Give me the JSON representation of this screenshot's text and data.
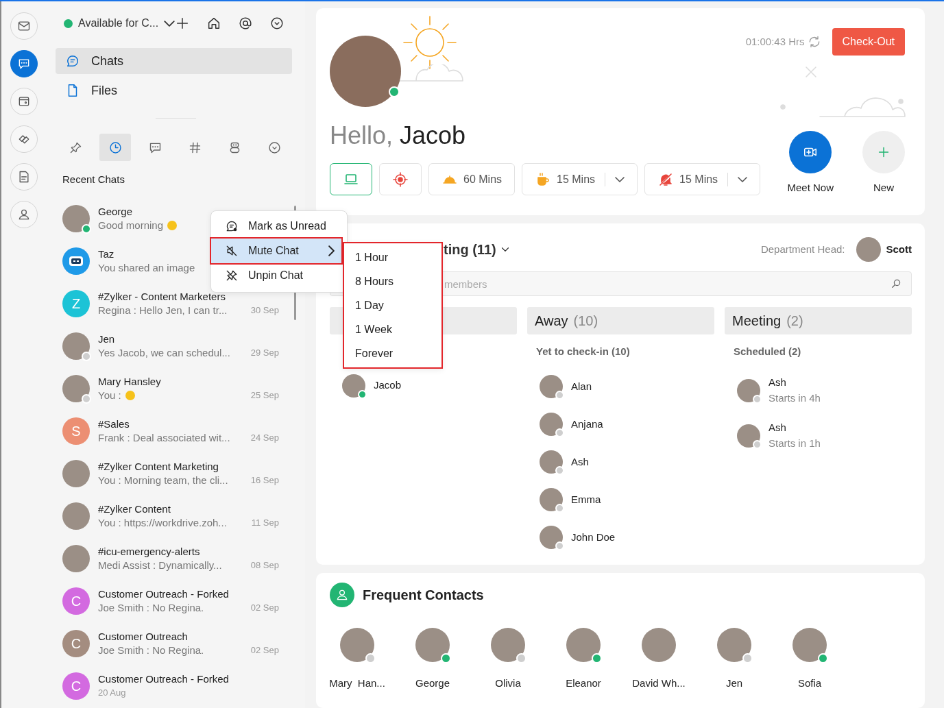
{
  "rail": [
    {
      "kind": "mail",
      "selected": false
    },
    {
      "kind": "chat",
      "selected": true
    },
    {
      "kind": "wallet",
      "selected": false
    },
    {
      "kind": "tag",
      "selected": false
    },
    {
      "kind": "note",
      "selected": false
    },
    {
      "kind": "person",
      "selected": false
    }
  ],
  "sidebar": {
    "status": {
      "label": "Available for C...",
      "color": "#22b573"
    },
    "nav": [
      {
        "kind": "chats",
        "label": "Chats",
        "selected": true
      },
      {
        "kind": "files",
        "label": "Files",
        "selected": false
      }
    ],
    "tabs": [
      {
        "kind": "pin",
        "selected": false
      },
      {
        "kind": "clock",
        "selected": true
      },
      {
        "kind": "chat",
        "selected": false
      },
      {
        "kind": "hash",
        "selected": false
      },
      {
        "kind": "bot",
        "selected": false
      },
      {
        "kind": "more",
        "selected": false
      }
    ],
    "section_title": "Recent Chats",
    "chats": [
      {
        "name": "George",
        "preview": "Good morning",
        "emoji": true,
        "avatar": {
          "kind": "photo"
        },
        "online": true
      },
      {
        "name": "Taz",
        "preview": "You shared an image",
        "avatar": {
          "kind": "bot"
        }
      },
      {
        "name": "#Zylker - Content Marketers",
        "preview": "Regina : Hello Jen, I can tr...",
        "time": "30 Sep",
        "avatar": {
          "kind": "letter",
          "letter": "Z",
          "color": "#1cc3d6"
        }
      },
      {
        "name": "Jen",
        "preview": "Yes Jacob, we can schedul...",
        "time": "29 Sep",
        "avatar": {
          "kind": "photo"
        },
        "online": false
      },
      {
        "name": "Mary Hansley",
        "preview": "You :",
        "emoji": true,
        "time": "25 Sep",
        "avatar": {
          "kind": "photo"
        },
        "online": false
      },
      {
        "name": "#Sales",
        "preview": "Frank : Deal associated wit...",
        "time": "24 Sep",
        "avatar": {
          "kind": "letter",
          "letter": "S",
          "color": "#ec8f73"
        }
      },
      {
        "name": "#Zylker Content Marketing",
        "preview": "You : Morning team, the cli...",
        "time": "16 Sep",
        "avatar": {
          "kind": "photo"
        }
      },
      {
        "name": "#Zylker Content",
        "preview": "You : https://workdrive.zoh...",
        "time": "11 Sep",
        "avatar": {
          "kind": "photo"
        }
      },
      {
        "name": "#icu-emergency-alerts",
        "preview": "Medi Assist : Dynamically...",
        "time": "08 Sep",
        "avatar": {
          "kind": "photo"
        }
      },
      {
        "name": "Customer Outreach - Forked",
        "preview": "Joe Smith : No Regina.",
        "time": "02 Sep",
        "avatar": {
          "kind": "letter",
          "letter": "C",
          "color": "#d36ae0"
        }
      },
      {
        "name": "Customer Outreach",
        "preview": "Joe Smith : No Regina.",
        "time": "02 Sep",
        "avatar": {
          "kind": "letter",
          "letter": "C",
          "color": "#a48d80"
        }
      },
      {
        "name": "Customer Outreach - Forked",
        "time": "20 Aug",
        "avatar": {
          "kind": "letter",
          "letter": "C",
          "color": "#d36ae0"
        }
      }
    ]
  },
  "context_menu": {
    "items": [
      {
        "kind": "unread",
        "label": "Mark as Unread",
        "selected": false
      },
      {
        "kind": "mute",
        "label": "Mute Chat",
        "selected": true,
        "submenu": true
      },
      {
        "kind": "unpin",
        "label": "Unpin Chat",
        "selected": false
      }
    ],
    "submenu": [
      "1 Hour",
      "8 Hours",
      "1 Day",
      "1 Week",
      "Forever"
    ]
  },
  "welcome": {
    "timer": "01:00:43 Hrs",
    "checkout": "Check-Out",
    "greeting": "Hello,",
    "user": "Jacob",
    "online": true,
    "status_buttons": [
      {
        "kind": "laptop",
        "selected": true
      },
      {
        "kind": "target",
        "selected": false
      },
      {
        "kind": "lunch",
        "label": "60 Mins",
        "selected": false
      },
      {
        "kind": "coffee",
        "label": "15 Mins",
        "dropdown": true,
        "selected": false
      },
      {
        "kind": "mute",
        "label": "15 Mins",
        "dropdown": true,
        "selected": false
      }
    ],
    "actions": [
      {
        "kind": "meet",
        "label": "Meet Now"
      },
      {
        "kind": "new",
        "label": "New"
      }
    ]
  },
  "team": {
    "title": "ting (11)",
    "department_head_label": "Department Head:",
    "department_head": "Scott",
    "search": {
      "placeholder": "members"
    },
    "columns": [
      {
        "members": [
          {
            "name": "Jacob",
            "online": true
          }
        ]
      },
      {
        "title": "Away",
        "count": "(10)",
        "subtitle": "Yet to check-in (10)",
        "members": [
          {
            "name": "Alan",
            "online": false
          },
          {
            "name": "Anjana",
            "online": false
          },
          {
            "name": "Ash",
            "online": false
          },
          {
            "name": "Emma",
            "online": false
          },
          {
            "name": "John Doe",
            "online": false
          }
        ]
      },
      {
        "title": "Meeting",
        "count": "(2)",
        "subtitle": "Scheduled (2)",
        "members": [
          {
            "name": "Ash",
            "detail": "Starts in 4h",
            "online": false
          },
          {
            "name": "Ash",
            "detail": "Starts in 1h",
            "online": false
          }
        ]
      }
    ]
  },
  "frequent": {
    "title": "Frequent Contacts",
    "contacts": [
      {
        "name": "Mary  Han...",
        "online": false
      },
      {
        "name": "George",
        "online": true
      },
      {
        "name": "Olivia",
        "online": false
      },
      {
        "name": "Eleanor",
        "online": true
      },
      {
        "name": "David Wh..."
      },
      {
        "name": "Jen",
        "online": false
      },
      {
        "name": "Sofia",
        "online": true
      }
    ]
  }
}
